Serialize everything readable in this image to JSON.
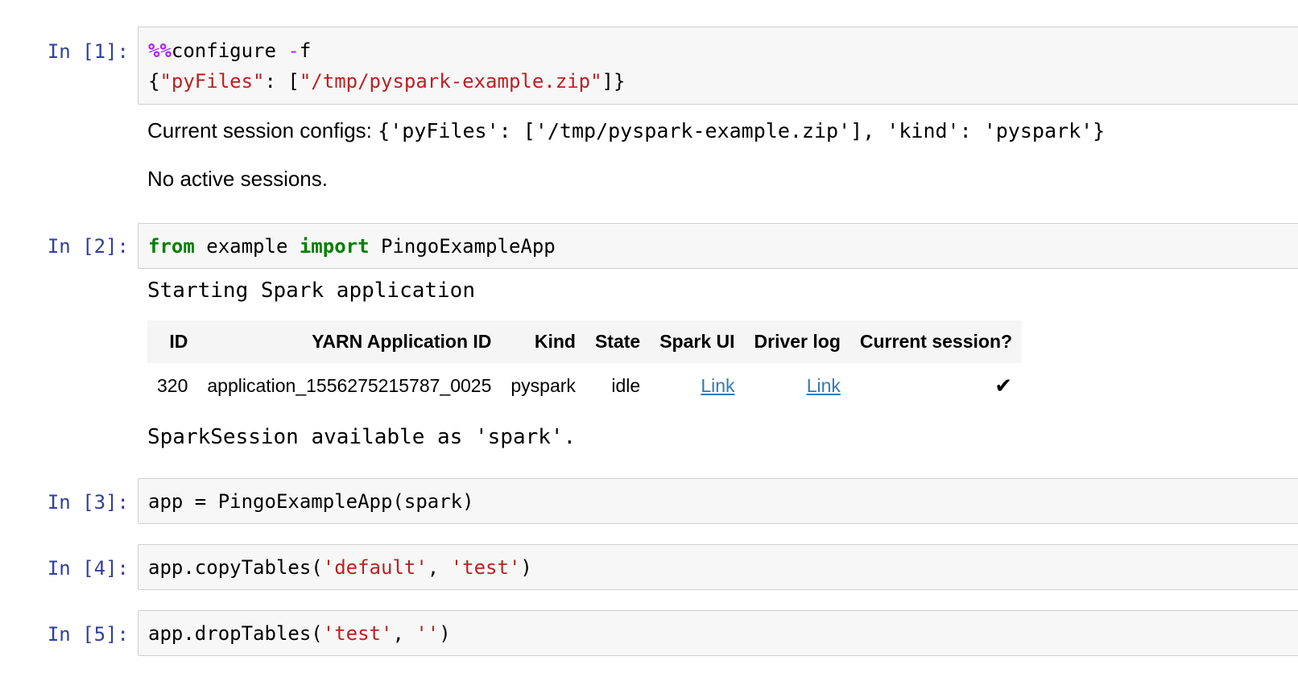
{
  "cells": [
    {
      "prompt": "In [1]:",
      "code": {
        "magic_op": "%%",
        "magic_cmd": "configure ",
        "flag_dash": "-",
        "flag_letter": "f",
        "line2_open": "{",
        "key": "\"pyFiles\"",
        "colon": ": [",
        "value": "\"/tmp/pyspark-example.zip\"",
        "close": "]}"
      },
      "output": {
        "configs_label": "Current session configs: ",
        "configs_value": "{'pyFiles': ['/tmp/pyspark-example.zip'], 'kind': 'pyspark'}",
        "status": "No active sessions."
      }
    },
    {
      "prompt": "In [2]:",
      "code": {
        "kw_from": "from",
        "module": " example ",
        "kw_import": "import",
        "name": " PingoExampleApp"
      },
      "output": {
        "starting": "Starting Spark application",
        "table": {
          "headers": [
            "ID",
            "YARN Application ID",
            "Kind",
            "State",
            "Spark UI",
            "Driver log",
            "Current session?"
          ],
          "row": {
            "id": "320",
            "app_id": "application_1556275215787_0025",
            "kind": "pyspark",
            "state": "idle",
            "spark_ui": "Link",
            "driver_log": "Link",
            "current": "✔"
          }
        },
        "available": "SparkSession available as 'spark'."
      }
    },
    {
      "prompt": "In [3]:",
      "code": {
        "text": "app = PingoExampleApp(spark)"
      }
    },
    {
      "prompt": "In [4]:",
      "code": {
        "pre": "app.copyTables(",
        "s1": "'default'",
        "mid": ", ",
        "s2": "'test'",
        "post": ")"
      }
    },
    {
      "prompt": "In [5]:",
      "code": {
        "pre": "app.dropTables(",
        "s1": "'test'",
        "mid": ", ",
        "s2": "''",
        "post": ")"
      }
    }
  ],
  "colors": {
    "prompt": "#303f9f",
    "keyword": "#008000",
    "string": "#ba2121",
    "magic": "#aa22ff",
    "link": "#337ab7",
    "cell_bg": "#f7f7f7"
  }
}
